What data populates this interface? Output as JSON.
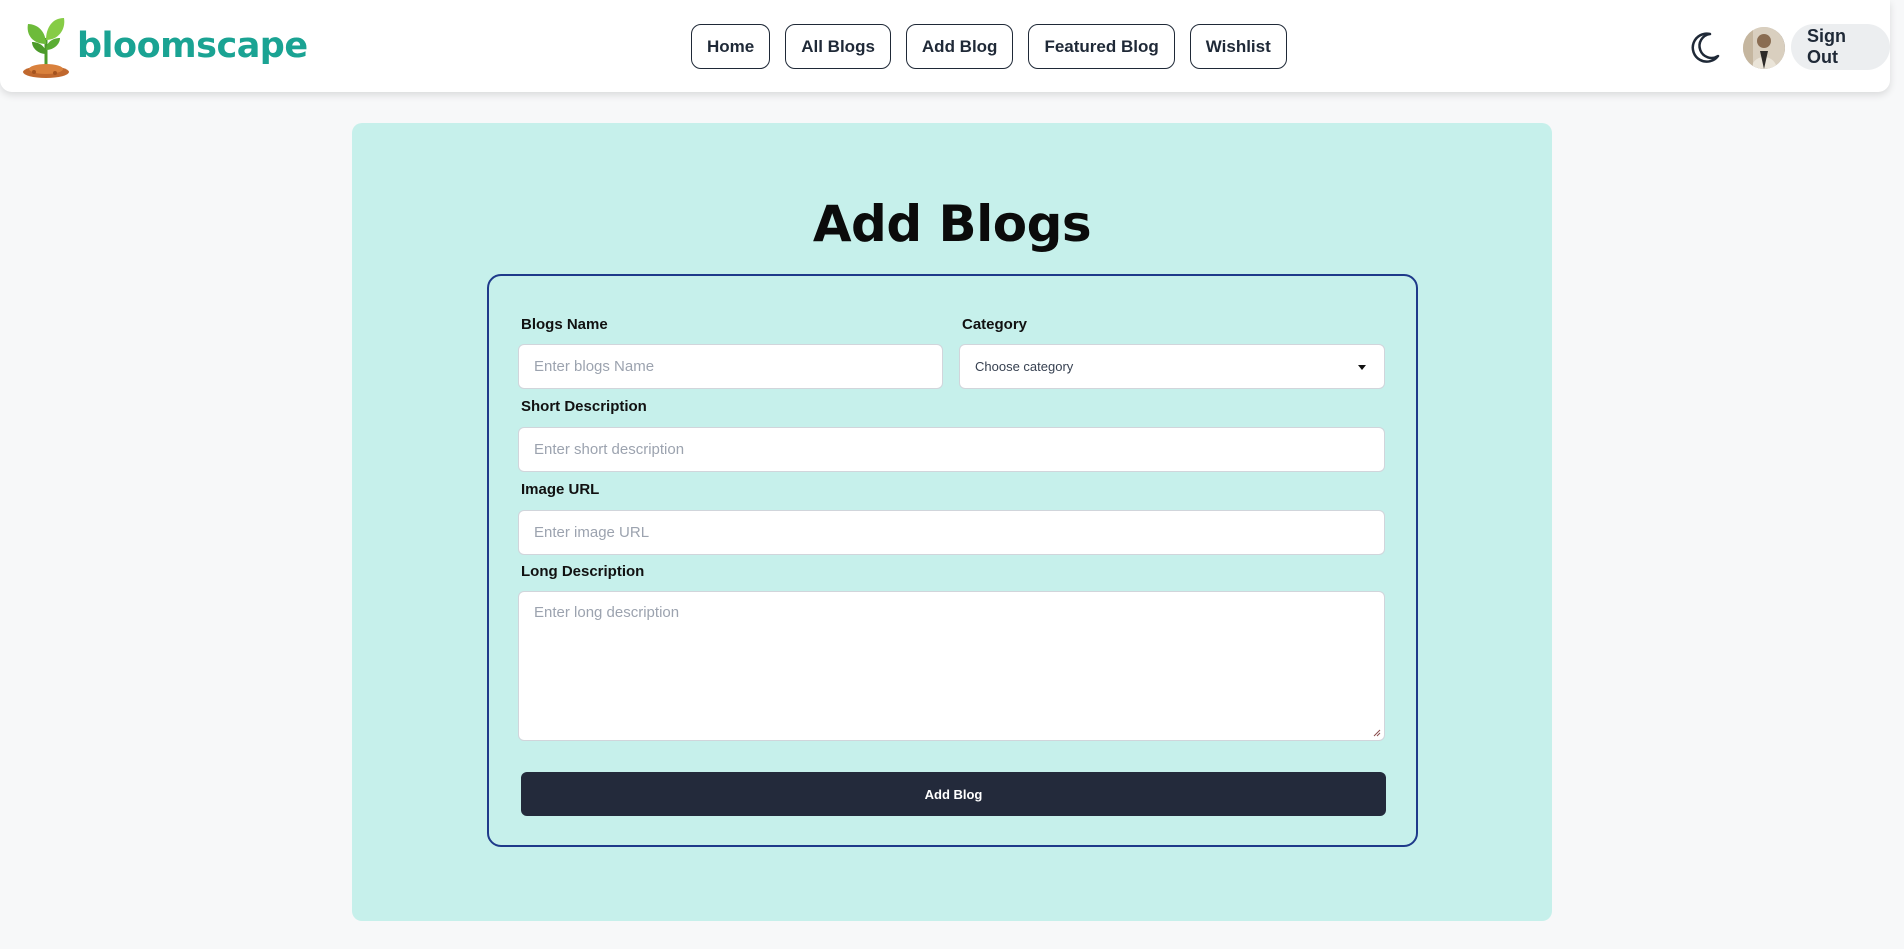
{
  "brand": {
    "name": "bloomscape",
    "logo_icon": "seedling-pot-icon"
  },
  "nav": {
    "links": [
      "Home",
      "All Blogs",
      "Add Blog",
      "Featured Blog",
      "Wishlist"
    ],
    "theme_icon": "moon-icon",
    "signout_label": "Sign Out"
  },
  "page": {
    "title": "Add Blogs"
  },
  "form": {
    "blog_name_label": "Blogs Name",
    "blog_name_placeholder": "Enter blogs Name",
    "category_label": "Category",
    "category_value": "Choose category",
    "short_desc_label": "Short Description",
    "short_desc_placeholder": "Enter short description",
    "image_url_label": "Image URL",
    "image_url_placeholder": "Enter image URL",
    "long_desc_label": "Long Description",
    "long_desc_placeholder": "Enter long description",
    "submit_label": "Add Blog"
  },
  "colors": {
    "brand": "#1aa393",
    "panel": "#c6f0eb",
    "card_border": "#1e3a8a",
    "submit_bg": "#232a3b"
  }
}
